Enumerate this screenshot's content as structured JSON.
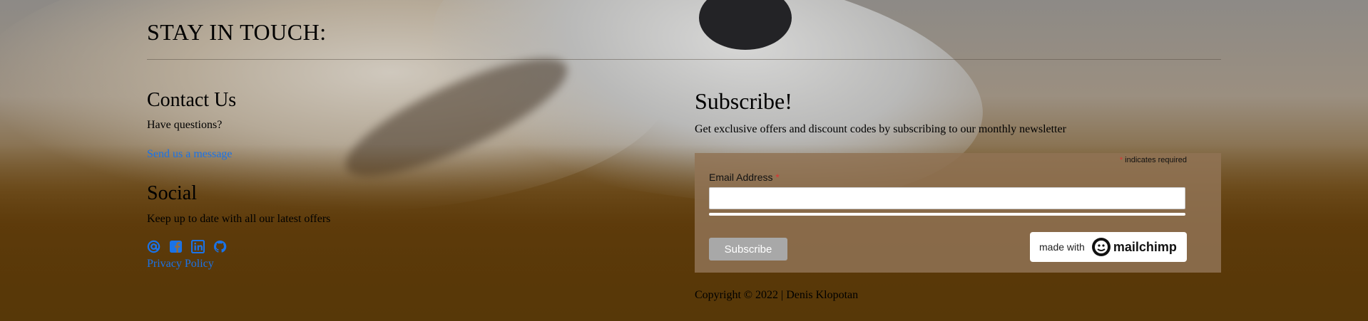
{
  "header": {
    "title": "STAY IN TOUCH:"
  },
  "contact": {
    "title": "Contact Us",
    "question": "Have questions?",
    "link_text": "Send us a message"
  },
  "social": {
    "title": "Social",
    "text": "Keep up to date with all our latest offers",
    "icons": [
      "at-icon",
      "facebook-icon",
      "linkedin-icon",
      "github-icon"
    ],
    "privacy": "Privacy Policy"
  },
  "subscribe": {
    "title": "Subscribe!",
    "description": "Get exclusive offers and discount codes by subscribing to our monthly newsletter",
    "required_note": "indicates required",
    "required_star": "*",
    "email_label": "Email Address",
    "email_value": "",
    "button": "Subscribe",
    "badge_with": "made with",
    "badge_brand": "mailchimp"
  },
  "footer": {
    "copyright": "Copyright © 2022 | Denis Klopotan"
  },
  "colors": {
    "link": "#1a73e8",
    "required": "#dd3333",
    "form_bg": "#917355",
    "button": "#a8a8a8"
  }
}
